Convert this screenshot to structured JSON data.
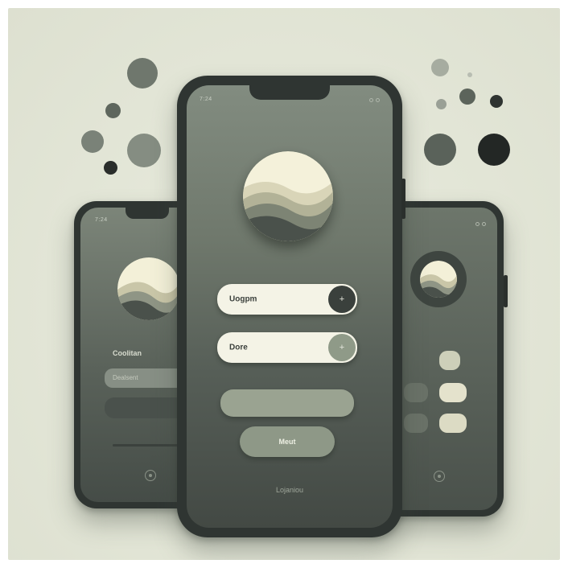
{
  "colors": {
    "background": "#e2e5d6",
    "phone_frame": "#2f3532",
    "screen_top": "#7f8a7e",
    "screen_bottom": "#3f4641",
    "field_bg": "#f4f3e6",
    "accent_dark": "#3a403c",
    "accent_sage": "#8f9a88",
    "light_pill": "#d7d9c2"
  },
  "center_phone": {
    "status_time": "7:24",
    "field_1": {
      "label": "Uogpm",
      "knob_icon": "+"
    },
    "field_2": {
      "label": "Dore",
      "knob_icon": "+"
    },
    "button_label": "Meut",
    "bottom_link": "Lojaniou"
  },
  "left_phone": {
    "status_time": "7:24",
    "heading": "Coolitan",
    "input_placeholder": "Dealsent"
  },
  "right_phone": {
    "status_time": ""
  }
}
